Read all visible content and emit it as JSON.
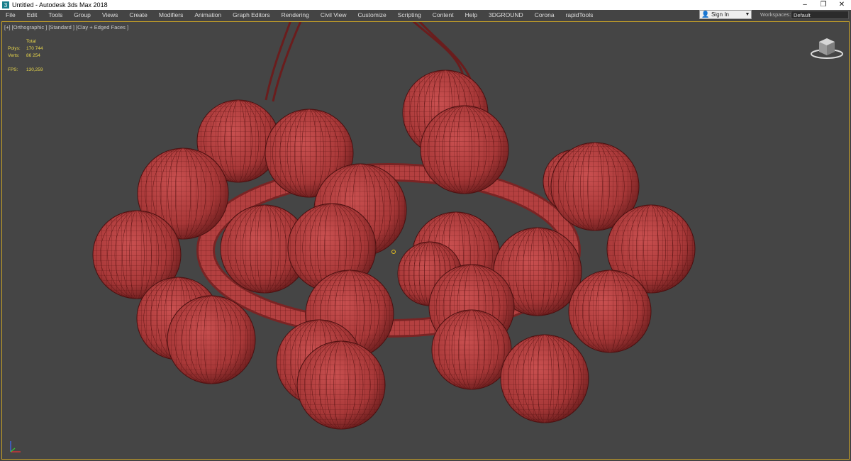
{
  "window": {
    "title": "Untitled - Autodesk 3ds Max 2018",
    "minimize": "–",
    "maximize": "❐",
    "close": "✕"
  },
  "menu": [
    "File",
    "Edit",
    "Tools",
    "Group",
    "Views",
    "Create",
    "Modifiers",
    "Animation",
    "Graph Editors",
    "Rendering",
    "Civil View",
    "Customize",
    "Scripting",
    "Content",
    "Help",
    "3DGROUND",
    "Corona",
    "rapidTools"
  ],
  "signin": {
    "label": "Sign In"
  },
  "workspaces": {
    "label": "Workspaces:",
    "value": "Default"
  },
  "viewport": {
    "label": "[+] [Orthographic ] [Standard ] [Clay + Edged Faces ]",
    "stats": {
      "header": "Total",
      "polys_label": "Polys:",
      "polys": "170 744",
      "verts_label": "Verts:",
      "verts": "86 254",
      "fps_label": "FPS:",
      "fps": "130,259"
    }
  },
  "colors": {
    "accent": "#c9a227",
    "clay": "#b33c3c",
    "wire": "#5a1414",
    "background": "#454545",
    "stats": "#e8d64a"
  },
  "icons": {
    "app": "3ds-max-logo-icon",
    "user": "user-icon",
    "viewcube": "viewcube-icon",
    "axis": "axis-tripod-icon"
  }
}
